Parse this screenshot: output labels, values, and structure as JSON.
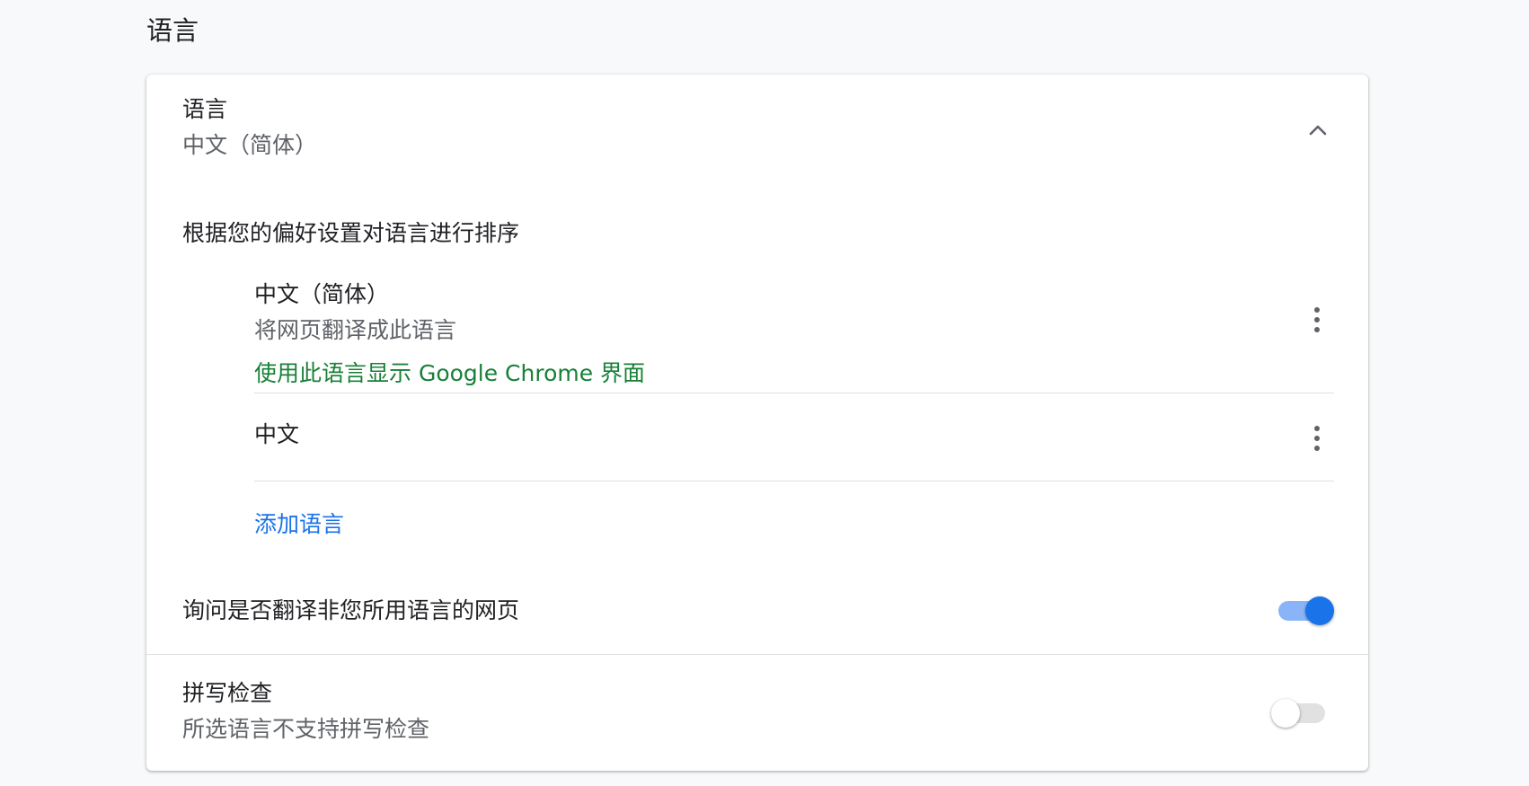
{
  "section_title": "语言",
  "language_header": {
    "title": "语言",
    "subtitle": "中文（简体）"
  },
  "order_label": "根据您的偏好设置对语言进行排序",
  "languages": [
    {
      "name": "中文（简体）",
      "note": "将网页翻译成此语言",
      "ui_note": "使用此语言显示 Google Chrome 界面"
    },
    {
      "name": "中文"
    }
  ],
  "add_language_label": "添加语言",
  "translate_offer": {
    "label": "询问是否翻译非您所用语言的网页",
    "enabled": true
  },
  "spell_check": {
    "title": "拼写检查",
    "subtitle": "所选语言不支持拼写检查",
    "enabled": false
  },
  "colors": {
    "accent": "#1a73e8",
    "ui_language_green": "#188038"
  }
}
